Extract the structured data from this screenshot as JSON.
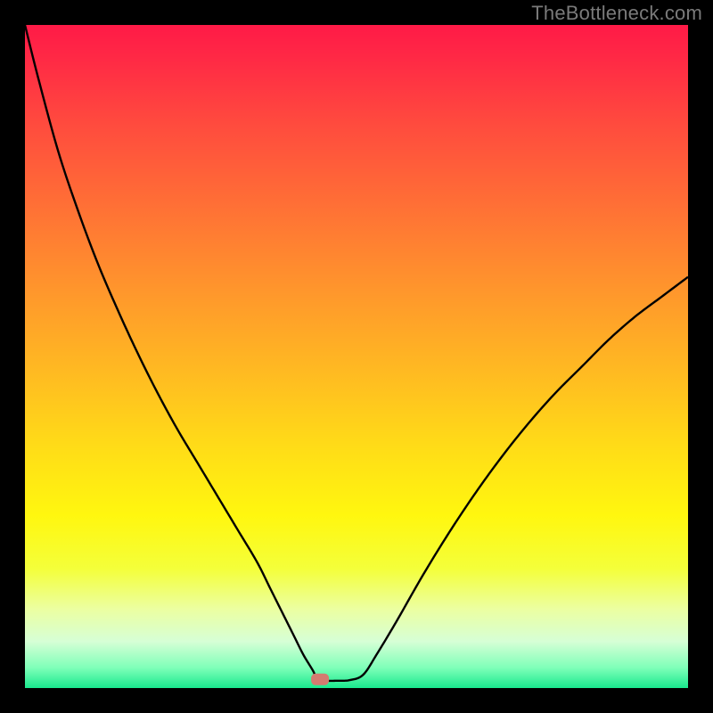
{
  "watermark": "TheBottleneck.com",
  "chart_data": {
    "type": "line",
    "title": "",
    "xlabel": "",
    "ylabel": "",
    "xlim": [
      0,
      100
    ],
    "ylim": [
      0,
      100
    ],
    "background_gradient": {
      "stops": [
        {
          "pos": 0.0,
          "color": "#ff1a47"
        },
        {
          "pos": 0.05,
          "color": "#ff2945"
        },
        {
          "pos": 0.15,
          "color": "#ff4b3e"
        },
        {
          "pos": 0.28,
          "color": "#ff7235"
        },
        {
          "pos": 0.4,
          "color": "#ff962c"
        },
        {
          "pos": 0.52,
          "color": "#ffb922"
        },
        {
          "pos": 0.64,
          "color": "#ffdd17"
        },
        {
          "pos": 0.74,
          "color": "#fff70f"
        },
        {
          "pos": 0.82,
          "color": "#f4ff3a"
        },
        {
          "pos": 0.88,
          "color": "#ecffa0"
        },
        {
          "pos": 0.93,
          "color": "#d6ffd6"
        },
        {
          "pos": 0.97,
          "color": "#7dffb8"
        },
        {
          "pos": 1.0,
          "color": "#19e98e"
        }
      ]
    },
    "marker": {
      "x": 44.5,
      "y": 1.3,
      "color": "#d47b70"
    },
    "series": [
      {
        "name": "curve",
        "x": [
          0,
          2,
          5,
          8,
          11,
          14,
          17,
          20,
          23,
          26,
          29,
          32,
          35,
          37,
          39,
          40.5,
          42,
          43.5,
          44,
          45,
          47,
          49,
          51,
          53,
          56,
          60,
          64,
          68,
          72,
          76,
          80,
          84,
          88,
          92,
          96,
          100
        ],
        "y": [
          100,
          92,
          81,
          72,
          64,
          57,
          50.5,
          44.5,
          39,
          34,
          29,
          24,
          19,
          15,
          11,
          8,
          5,
          2.5,
          1.2,
          1.1,
          1.1,
          1.2,
          2,
          5,
          10,
          17,
          23.5,
          29.5,
          35,
          40,
          44.5,
          48.5,
          52.5,
          56,
          59,
          62
        ]
      }
    ]
  }
}
